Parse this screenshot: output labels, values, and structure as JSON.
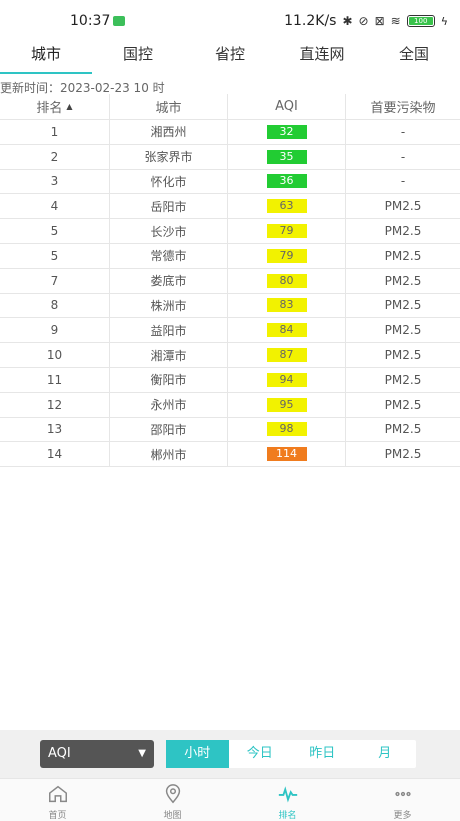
{
  "status": {
    "time": "10:37",
    "network_speed": "11.2K/s",
    "battery": "100"
  },
  "tabs": [
    {
      "label": "城市",
      "active": true
    },
    {
      "label": "国控",
      "active": false
    },
    {
      "label": "省控",
      "active": false
    },
    {
      "label": "直连网",
      "active": false
    },
    {
      "label": "全国",
      "active": false
    }
  ],
  "update_time": "更新时间：2023-02-23 10 时",
  "table": {
    "headers": {
      "rank": "排名",
      "city": "城市",
      "aqi": "AQI",
      "pollutant": "首要污染物"
    },
    "rows": [
      {
        "rank": "1",
        "city": "湘西州",
        "aqi": "32",
        "color": "#22cc33",
        "pollutant": "-"
      },
      {
        "rank": "2",
        "city": "张家界市",
        "aqi": "35",
        "color": "#22cc33",
        "pollutant": "-"
      },
      {
        "rank": "3",
        "city": "怀化市",
        "aqi": "36",
        "color": "#22cc33",
        "pollutant": "-"
      },
      {
        "rank": "4",
        "city": "岳阳市",
        "aqi": "63",
        "color": "#f2f200",
        "pollutant": "PM2.5"
      },
      {
        "rank": "5",
        "city": "长沙市",
        "aqi": "79",
        "color": "#f2f200",
        "pollutant": "PM2.5"
      },
      {
        "rank": "5",
        "city": "常德市",
        "aqi": "79",
        "color": "#f2f200",
        "pollutant": "PM2.5"
      },
      {
        "rank": "7",
        "city": "娄底市",
        "aqi": "80",
        "color": "#f2f200",
        "pollutant": "PM2.5"
      },
      {
        "rank": "8",
        "city": "株洲市",
        "aqi": "83",
        "color": "#f2f200",
        "pollutant": "PM2.5"
      },
      {
        "rank": "9",
        "city": "益阳市",
        "aqi": "84",
        "color": "#f2f200",
        "pollutant": "PM2.5"
      },
      {
        "rank": "10",
        "city": "湘潭市",
        "aqi": "87",
        "color": "#f2f200",
        "pollutant": "PM2.5"
      },
      {
        "rank": "11",
        "city": "衡阳市",
        "aqi": "94",
        "color": "#f2f200",
        "pollutant": "PM2.5"
      },
      {
        "rank": "12",
        "city": "永州市",
        "aqi": "95",
        "color": "#f2f200",
        "pollutant": "PM2.5"
      },
      {
        "rank": "13",
        "city": "邵阳市",
        "aqi": "98",
        "color": "#f2f200",
        "pollutant": "PM2.5"
      },
      {
        "rank": "14",
        "city": "郴州市",
        "aqi": "114",
        "color": "#f07c1e",
        "pollutant": "PM2.5"
      }
    ]
  },
  "filter": {
    "select_value": "AQI",
    "periods": [
      {
        "label": "小时",
        "active": true
      },
      {
        "label": "今日",
        "active": false
      },
      {
        "label": "昨日",
        "active": false
      },
      {
        "label": "月",
        "active": false
      }
    ]
  },
  "nav": [
    {
      "label": "首页",
      "icon": "home-icon",
      "active": false
    },
    {
      "label": "地图",
      "icon": "map-pin-icon",
      "active": false
    },
    {
      "label": "排名",
      "icon": "pulse-icon",
      "active": true
    },
    {
      "label": "更多",
      "icon": "more-icon",
      "active": false
    }
  ],
  "colors": {
    "accent": "#2ec4c4",
    "good": "#22cc33",
    "moderate": "#f2f200",
    "sensitive": "#f07c1e"
  }
}
